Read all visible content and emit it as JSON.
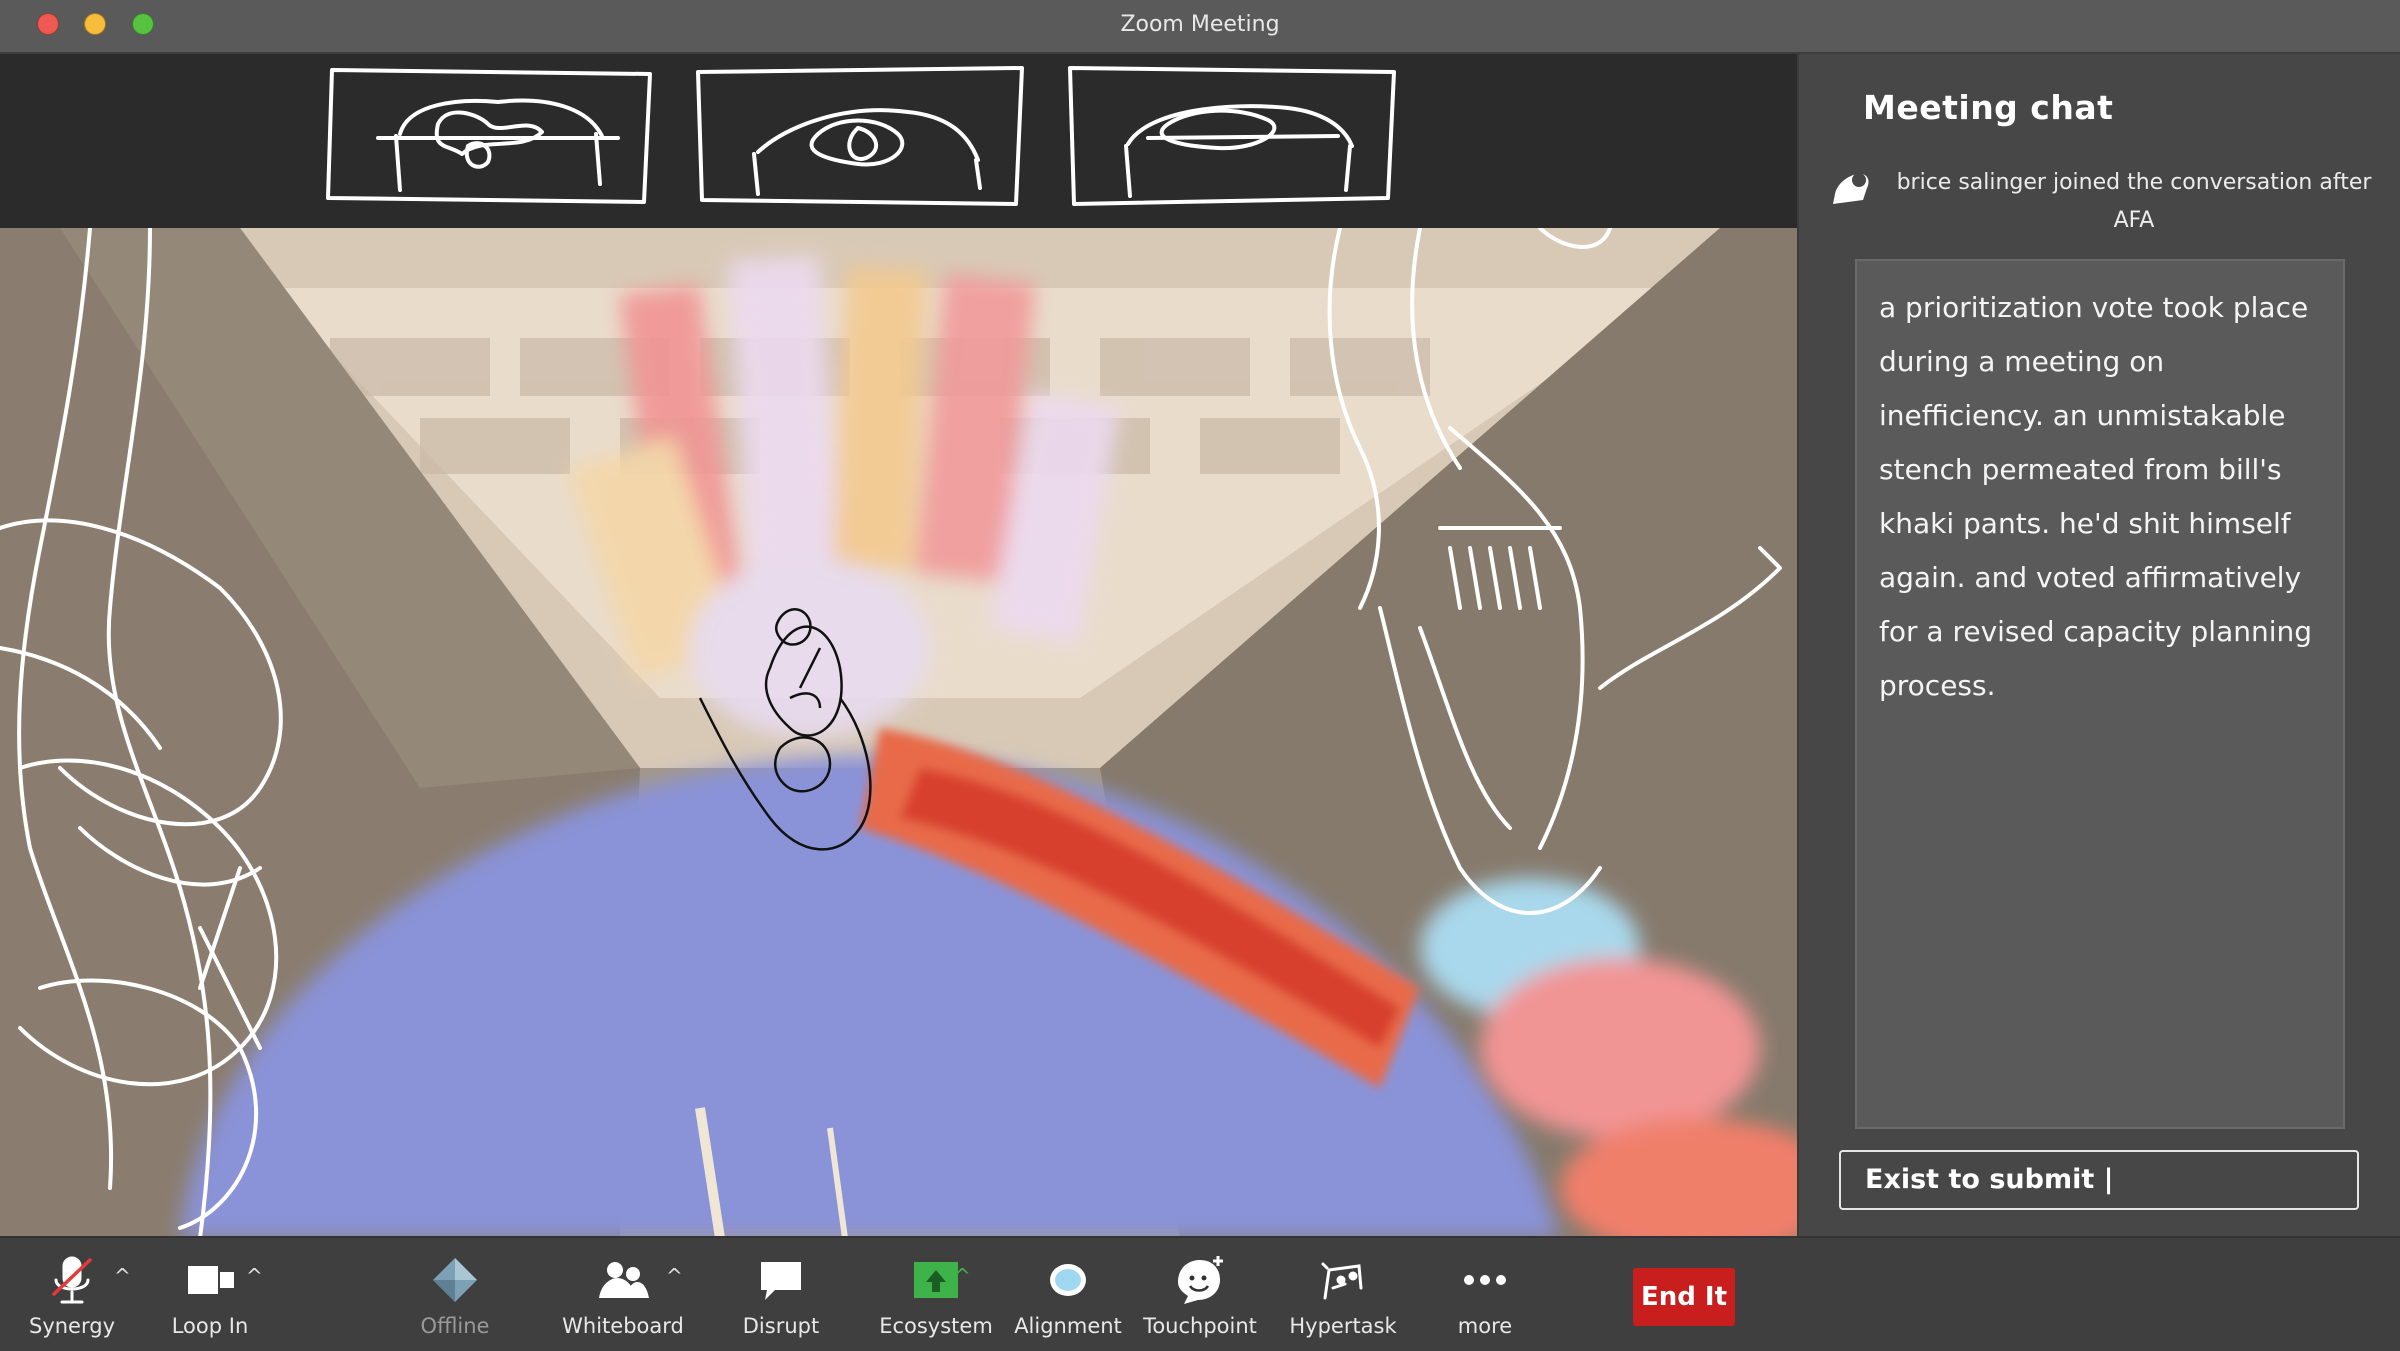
{
  "window": {
    "title": "Zoom Meeting",
    "traffic_colors": {
      "close": "#ee5a52",
      "minimize": "#f5bd3a",
      "maximize": "#56c23f"
    }
  },
  "thumbnails": [
    {
      "name": "participant-thumbnail-1"
    },
    {
      "name": "participant-thumbnail-2"
    },
    {
      "name": "participant-thumbnail-3"
    }
  ],
  "chat": {
    "title": "Meeting chat",
    "join_notice": "brice salinger joined the conversation after AFA",
    "message": "a prioritization vote took place during a meeting on inefficiency. an unmistakable stench permeated from bill's khaki pants. he'd shit himself again. and voted affirmatively for a revised capacity planning process.",
    "input_text": "Exist to submit |"
  },
  "toolbar": {
    "synergy": "Synergy",
    "loop_in": "Loop In",
    "offline": "Offline",
    "whiteboard": "Whiteboard",
    "disrupt": "Disrupt",
    "ecosystem": "Ecosystem",
    "alignment": "Alignment",
    "touchpoint": "Touchpoint",
    "hypertask": "Hypertask",
    "more": "more",
    "end": "End It"
  },
  "colors": {
    "accent_green": "#3db34a",
    "end_red": "#c81e1e",
    "alignment_blue": "#9fd8f0"
  }
}
